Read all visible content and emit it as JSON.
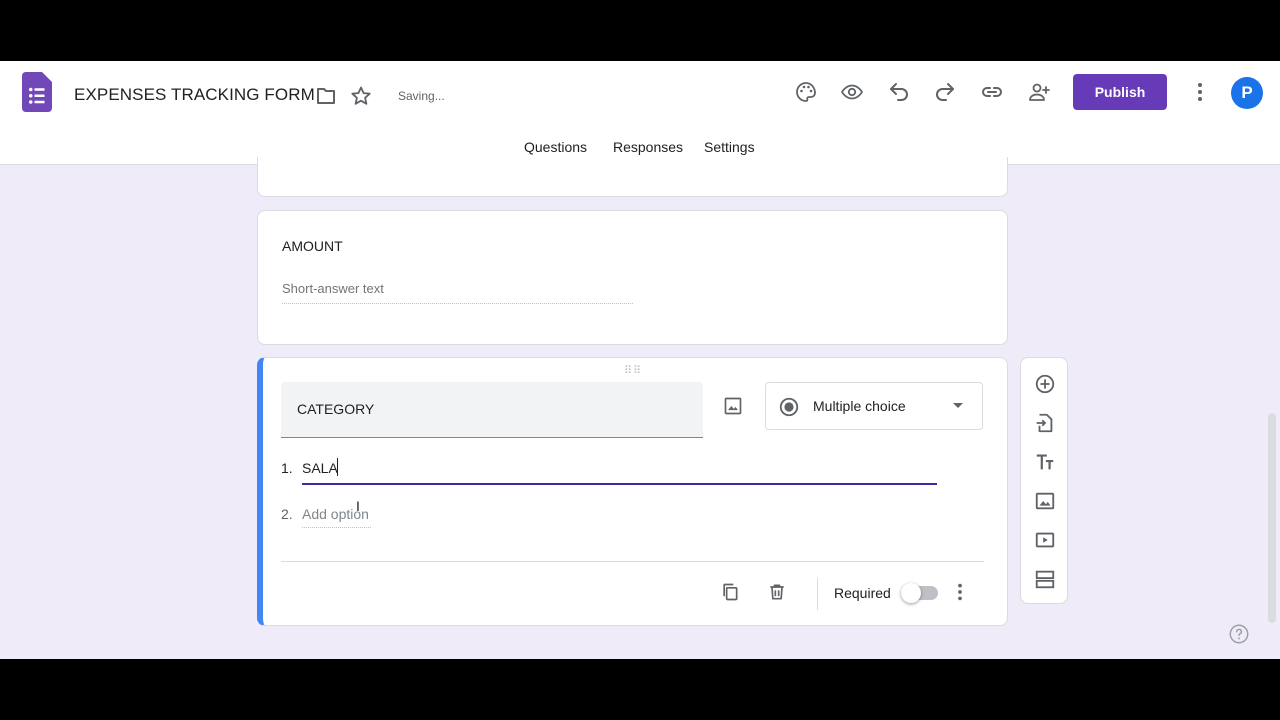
{
  "header": {
    "form_title": "EXPENSES TRACKING FORM",
    "saving_status": "Saving...",
    "publish_label": "Publish",
    "avatar_initial": "P"
  },
  "tabs": [
    {
      "label": "Questions",
      "active": true
    },
    {
      "label": "Responses",
      "active": false
    },
    {
      "label": "Settings",
      "active": false
    }
  ],
  "questions": {
    "amount": {
      "title": "AMOUNT",
      "answer_placeholder": "Short-answer text"
    },
    "category": {
      "title": "CATEGORY",
      "type": "Multiple choice",
      "options": [
        {
          "number": "1.",
          "value": "SALA"
        },
        {
          "number": "2.",
          "placeholder": "Add option"
        }
      ],
      "required_label": "Required",
      "required": false
    }
  },
  "icons": {
    "app_logo": "forms-icon",
    "folder": "folder-icon",
    "star": "star-icon",
    "theme": "palette-icon",
    "preview": "eye-icon",
    "undo": "undo-icon",
    "redo": "redo-icon",
    "link": "link-icon",
    "add_collaborator": "person-add-icon",
    "more": "more-vert-icon"
  },
  "colors": {
    "accent": "#673ab7",
    "background": "#f0ebf8",
    "active_card_border": "#4285f4",
    "avatar": "#1a73e8"
  }
}
